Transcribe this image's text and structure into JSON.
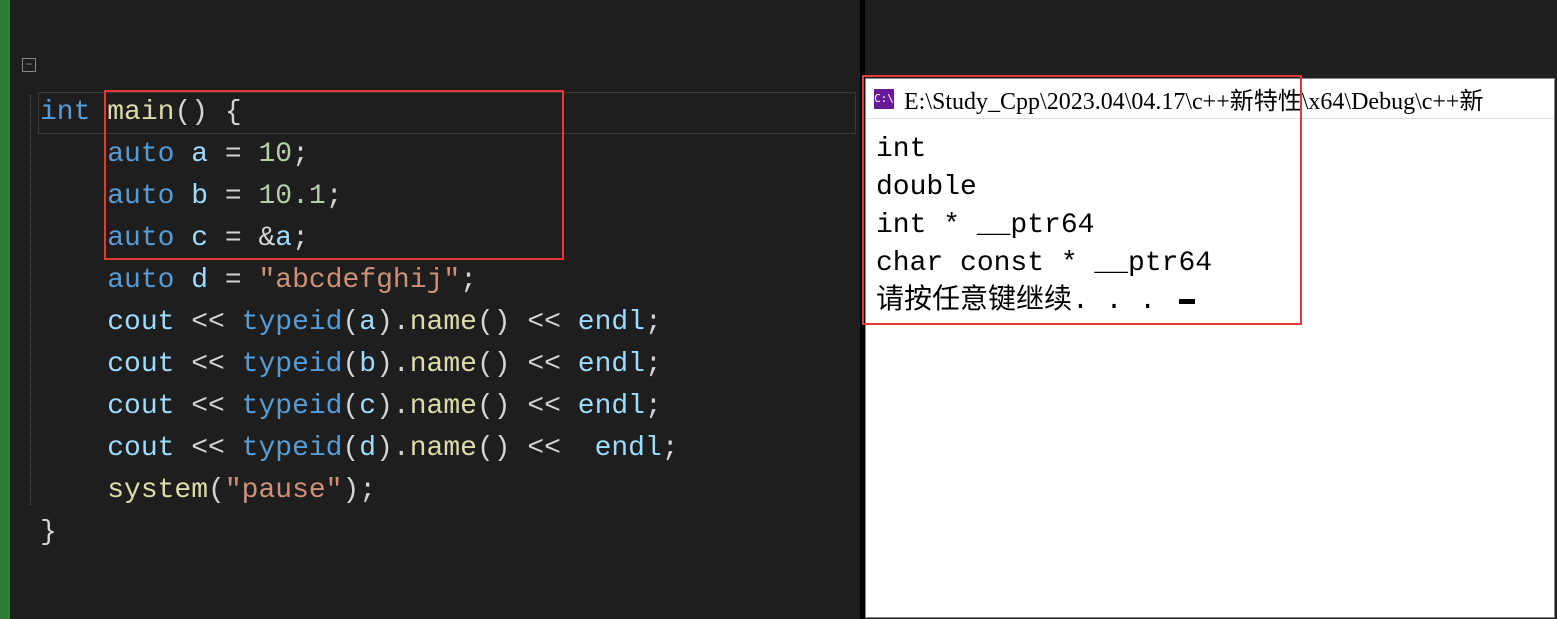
{
  "editor": {
    "fold_glyph": "−",
    "lines": {
      "l1": [
        [
          "kw",
          "int"
        ],
        [
          "plain",
          " "
        ],
        [
          "fn",
          "main"
        ],
        [
          "plain",
          "() {"
        ]
      ],
      "l2": [
        [
          "plain",
          "    "
        ],
        [
          "kw",
          "auto"
        ],
        [
          "plain",
          " "
        ],
        [
          "id",
          "a"
        ],
        [
          "plain",
          " "
        ],
        [
          "op",
          "="
        ],
        [
          "plain",
          " "
        ],
        [
          "num",
          "10"
        ],
        [
          "plain",
          ";"
        ]
      ],
      "l3": [
        [
          "plain",
          "    "
        ],
        [
          "kw",
          "auto"
        ],
        [
          "plain",
          " "
        ],
        [
          "id",
          "b"
        ],
        [
          "plain",
          " "
        ],
        [
          "op",
          "="
        ],
        [
          "plain",
          " "
        ],
        [
          "num",
          "10.1"
        ],
        [
          "plain",
          ";"
        ]
      ],
      "l4": [
        [
          "plain",
          "    "
        ],
        [
          "kw",
          "auto"
        ],
        [
          "plain",
          " "
        ],
        [
          "id",
          "c"
        ],
        [
          "plain",
          " "
        ],
        [
          "op",
          "="
        ],
        [
          "plain",
          " &"
        ],
        [
          "id",
          "a"
        ],
        [
          "plain",
          ";"
        ]
      ],
      "l5": [
        [
          "plain",
          "    "
        ],
        [
          "kw",
          "auto"
        ],
        [
          "plain",
          " "
        ],
        [
          "id",
          "d"
        ],
        [
          "plain",
          " "
        ],
        [
          "op",
          "="
        ],
        [
          "plain",
          " "
        ],
        [
          "str",
          "\"abcdefghij\""
        ],
        [
          "plain",
          ";"
        ]
      ],
      "l6": [
        [
          "plain",
          "    "
        ],
        [
          "id",
          "cout"
        ],
        [
          "plain",
          " << "
        ],
        [
          "kw",
          "typeid"
        ],
        [
          "plain",
          "("
        ],
        [
          "id",
          "a"
        ],
        [
          "plain",
          ")."
        ],
        [
          "fn",
          "name"
        ],
        [
          "plain",
          "() << "
        ],
        [
          "id",
          "endl"
        ],
        [
          "plain",
          ";"
        ]
      ],
      "l7": [
        [
          "plain",
          "    "
        ],
        [
          "id",
          "cout"
        ],
        [
          "plain",
          " << "
        ],
        [
          "kw",
          "typeid"
        ],
        [
          "plain",
          "("
        ],
        [
          "id",
          "b"
        ],
        [
          "plain",
          ")."
        ],
        [
          "fn",
          "name"
        ],
        [
          "plain",
          "() << "
        ],
        [
          "id",
          "endl"
        ],
        [
          "plain",
          ";"
        ]
      ],
      "l8": [
        [
          "plain",
          "    "
        ],
        [
          "id",
          "cout"
        ],
        [
          "plain",
          " << "
        ],
        [
          "kw",
          "typeid"
        ],
        [
          "plain",
          "("
        ],
        [
          "id",
          "c"
        ],
        [
          "plain",
          ")."
        ],
        [
          "fn",
          "name"
        ],
        [
          "plain",
          "() << "
        ],
        [
          "id",
          "endl"
        ],
        [
          "plain",
          ";"
        ]
      ],
      "l9": [
        [
          "plain",
          "    "
        ],
        [
          "id",
          "cout"
        ],
        [
          "plain",
          " << "
        ],
        [
          "kw",
          "typeid"
        ],
        [
          "plain",
          "("
        ],
        [
          "id",
          "d"
        ],
        [
          "plain",
          ")."
        ],
        [
          "fn",
          "name"
        ],
        [
          "plain",
          "() <<  "
        ],
        [
          "id",
          "endl"
        ],
        [
          "plain",
          ";"
        ]
      ],
      "l10": [
        [
          "plain",
          "    "
        ],
        [
          "fn",
          "system"
        ],
        [
          "plain",
          "("
        ],
        [
          "str",
          "\"pause\""
        ],
        [
          "plain",
          ");"
        ]
      ],
      "l11": [
        [
          "plain",
          "}"
        ]
      ]
    }
  },
  "console": {
    "icon_text": "C:\\",
    "title": "E:\\Study_Cpp\\2023.04\\04.17\\c++新特性\\x64\\Debug\\c++新",
    "out1": "int",
    "out2": "double",
    "out3": "int * __ptr64",
    "out4": "char const * __ptr64",
    "out5": "请按任意键继续. . . "
  }
}
